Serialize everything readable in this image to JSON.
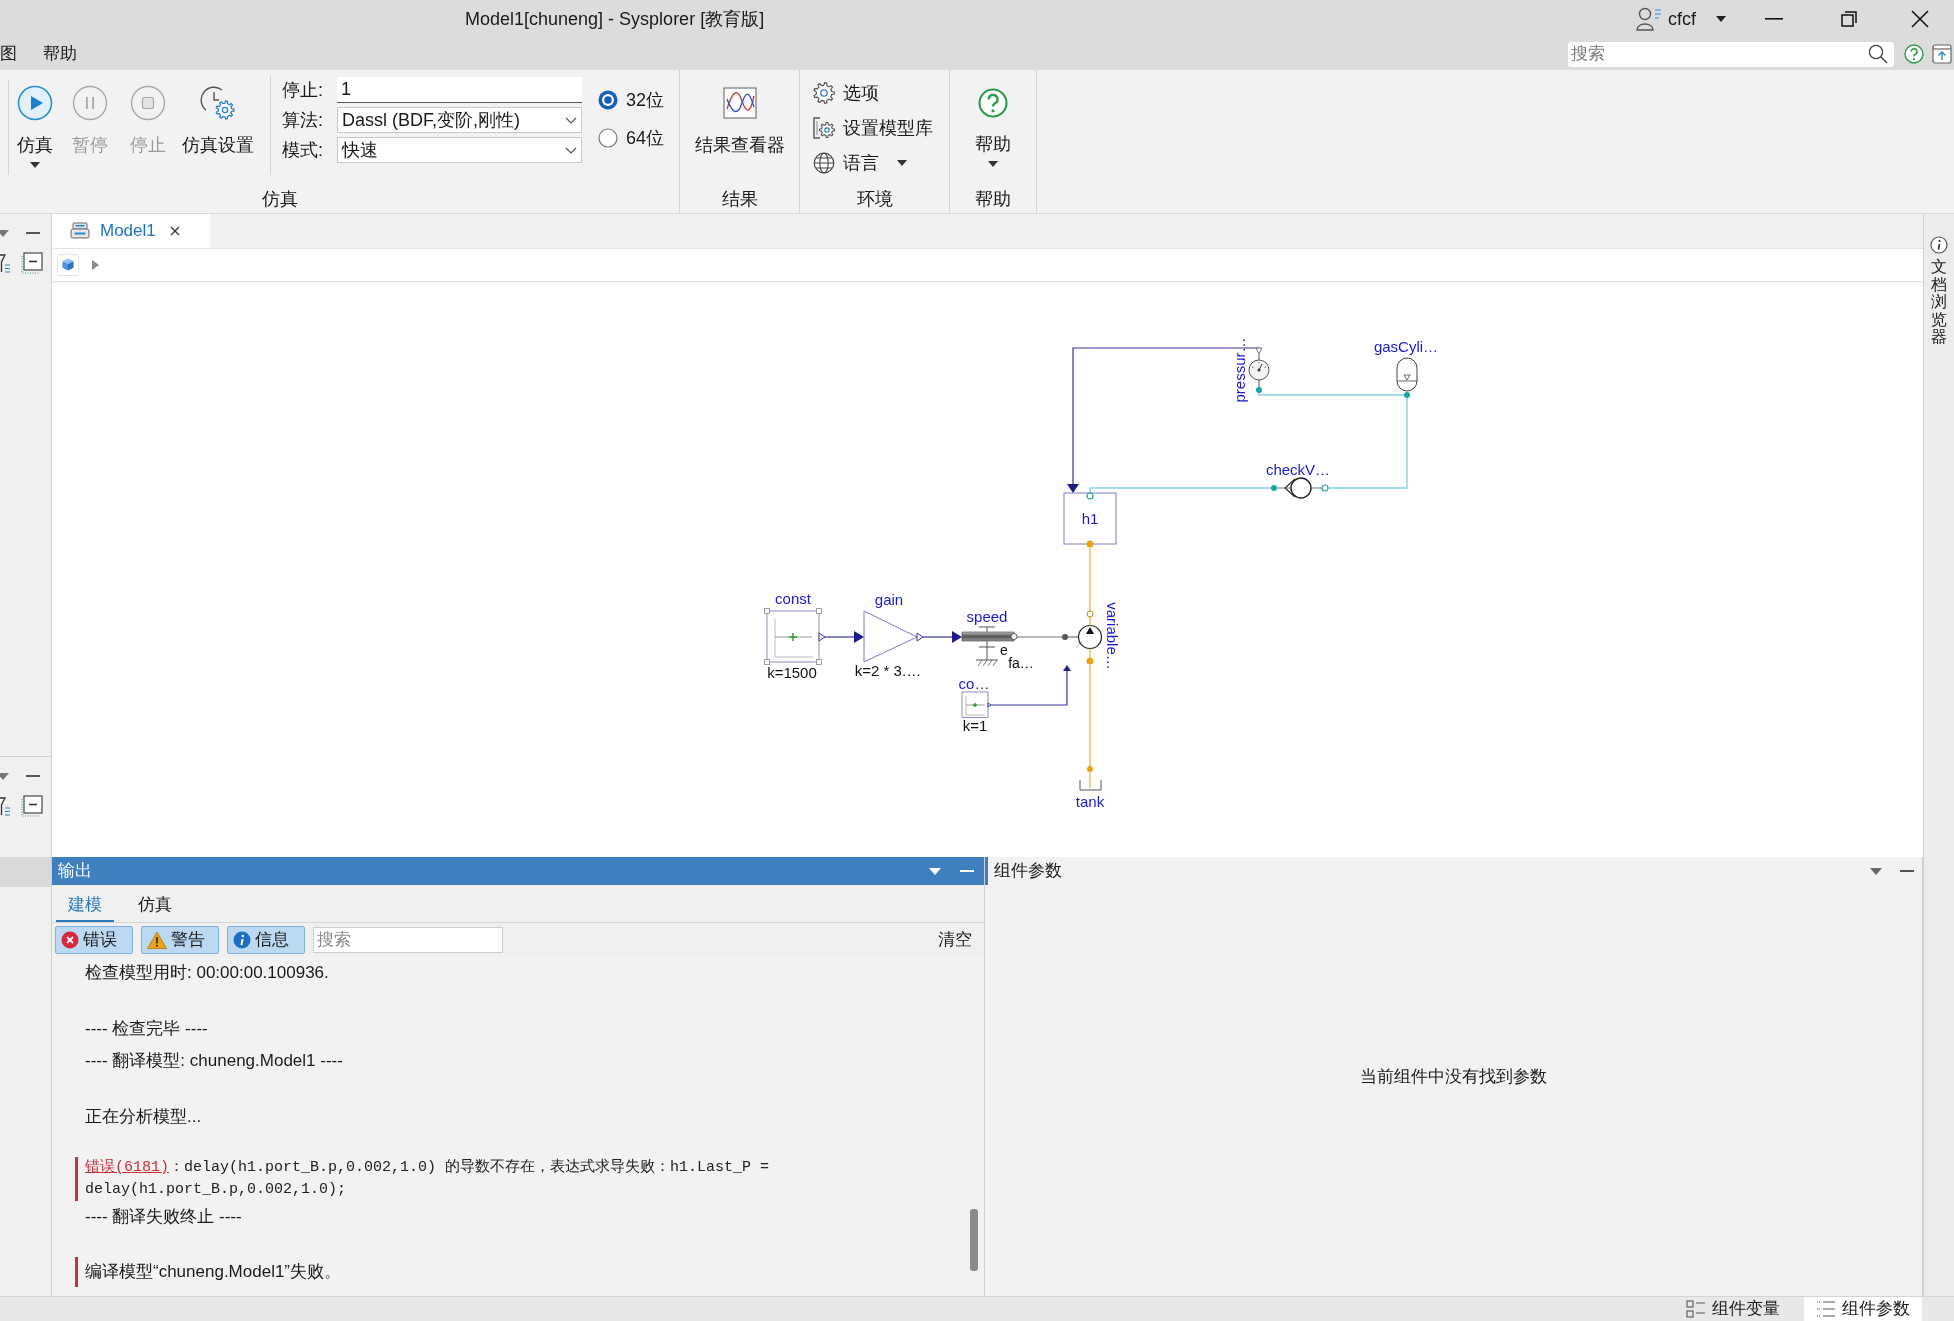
{
  "window": {
    "title": "Model1[chuneng] - Sysplorer [教育版]",
    "user": "cfcf"
  },
  "menu": [
    {
      "label": "图"
    },
    {
      "label": "帮助"
    }
  ],
  "search": {
    "placeholder": "搜索"
  },
  "ribbon": {
    "simulation": {
      "title": "仿真",
      "buttons": [
        {
          "label": "仿真",
          "disabled": false,
          "dropdown": true
        },
        {
          "label": "暂停",
          "disabled": true,
          "dropdown": false
        },
        {
          "label": "停止",
          "disabled": true,
          "dropdown": false
        },
        {
          "label": "仿真设置",
          "disabled": false,
          "dropdown": false
        }
      ],
      "fields": [
        {
          "kind": "text",
          "label": "停止:",
          "value": "1"
        },
        {
          "kind": "select",
          "label": "算法:",
          "value": "Dassl (BDF,变阶,刚性)"
        },
        {
          "kind": "select",
          "label": "模式:",
          "value": "快速"
        }
      ],
      "bitness": [
        {
          "label": "32位",
          "selected": true
        },
        {
          "label": "64位",
          "selected": false
        }
      ]
    },
    "results": {
      "title": "结果",
      "buttons": [
        {
          "label": "结果查看器"
        }
      ]
    },
    "environment": {
      "title": "环境",
      "items": [
        {
          "label": "选项",
          "dropdown": false
        },
        {
          "label": "设置模型库",
          "dropdown": false
        },
        {
          "label": "语言",
          "dropdown": true
        }
      ]
    },
    "help": {
      "title": "帮助",
      "buttons": [
        {
          "label": "帮助",
          "dropdown": true
        }
      ]
    }
  },
  "document_tabs": [
    {
      "label": "Model1",
      "selected": true
    }
  ],
  "diagram": {
    "components": [
      {
        "kind": "pressure_sensor",
        "label": "pressur…",
        "selected": false
      },
      {
        "kind": "gas_cylinder",
        "label": "gasCyli…",
        "selected": false
      },
      {
        "kind": "check_valve",
        "label": "checkV…",
        "selected": false
      },
      {
        "kind": "volume",
        "label": "h1",
        "selected": false
      },
      {
        "kind": "constant",
        "label": "const",
        "param": "k=1500",
        "selected": true
      },
      {
        "kind": "gain",
        "label": "gain",
        "param": "k=2 * 3.…",
        "selected": false
      },
      {
        "kind": "speed_source",
        "label": "speed",
        "notes": [
          "e",
          "fa…"
        ],
        "selected": false
      },
      {
        "kind": "pump",
        "label": "variable…",
        "selected": false
      },
      {
        "kind": "constant",
        "label": "co…",
        "param": "k=1",
        "selected": false
      },
      {
        "kind": "tank",
        "label": "tank",
        "selected": false
      }
    ]
  },
  "output": {
    "title": "输出",
    "tabs": [
      {
        "label": "建模",
        "selected": true
      },
      {
        "label": "仿真",
        "selected": false
      }
    ],
    "filters": [
      {
        "kind": "error",
        "label": "错误",
        "selected": true
      },
      {
        "kind": "warning",
        "label": "警告",
        "selected": true
      },
      {
        "kind": "info",
        "label": "信息",
        "selected": true
      }
    ],
    "search": {
      "placeholder": "搜索"
    },
    "clear_button": "清空",
    "blocks": [
      [
        {
          "kind": "plain",
          "text": "检查模型用时: 00:00:00.100936."
        }
      ],
      [
        {
          "kind": "plain",
          "text": "---- 检查完毕 ----"
        },
        {
          "kind": "plain",
          "text": "---- 翻译模型: chuneng.Model1 ----"
        }
      ],
      [
        {
          "kind": "plain",
          "text": "正在分析模型..."
        }
      ],
      [
        {
          "kind": "diagnostic",
          "code": "错误(6181)",
          "text": "：delay(h1.port_B.p,0.002,1.0) 的导数不存在，表达式求导失败：h1.Last_P = delay(h1.port_B.p,0.002,1.0);"
        },
        {
          "kind": "plain",
          "text": "---- 翻译失败终止 ----"
        }
      ],
      [
        {
          "kind": "error",
          "text": "编译模型“chuneng.Model1”失败。"
        }
      ]
    ]
  },
  "parameters": {
    "title": "组件参数",
    "empty_message": "当前组件中没有找到参数"
  },
  "bottom_tabs": [
    {
      "label": "组件变量",
      "selected": false
    },
    {
      "label": "组件参数",
      "selected": true
    }
  ],
  "side_panel": {
    "label": "文档浏览器"
  }
}
